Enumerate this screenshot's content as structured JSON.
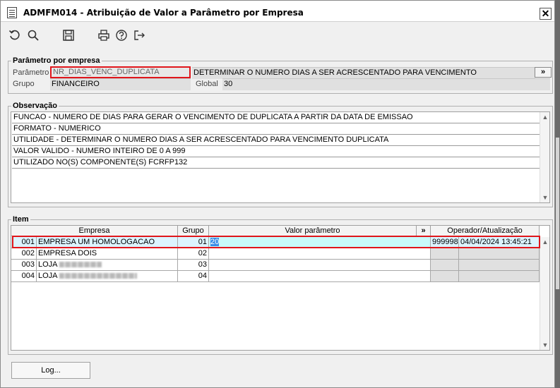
{
  "window": {
    "title": "ADMFM014 - Atribuição de Valor a Parâmetro por Empresa",
    "close_label": "✕"
  },
  "toolbar": {
    "icons": [
      "refresh-icon",
      "search-icon",
      "save-icon",
      "print-icon",
      "help-icon",
      "exit-icon"
    ]
  },
  "param_group": {
    "title": "Parâmetro por empresa",
    "param_label": "Parâmetro",
    "param_value": "NR_DIAS_VENC_DUPLICATA",
    "param_desc": "DETERMINAR O NUMERO DIAS A SER ACRESCENTADO PARA VENCIMENTO",
    "expand_label": "»",
    "group_label": "Grupo",
    "group_value": "FINANCEIRO",
    "global_label": "Global",
    "global_value": "30"
  },
  "observacao": {
    "title": "Observação",
    "lines": [
      "FUNCAO - NUMERO DE DIAS PARA GERAR O VENCIMENTO DE DUPLICATA A PARTIR DA DATA DE EMISSAO",
      "FORMATO - NUMERICO",
      "UTILIDADE - DETERMINAR O NUMERO DIAS A SER ACRESCENTADO PARA VENCIMENTO DUPLICATA",
      "VALOR VALIDO - NUMERO INTEIRO DE 0 A 999",
      "UTILIZADO NO(S) COMPONENTE(S) FCRFP132"
    ]
  },
  "item_group": {
    "title": "Item",
    "headers": {
      "empresa": "Empresa",
      "grupo": "Grupo",
      "valor": "Valor parâmetro",
      "expand": "»",
      "operador": "Operador/Atualização"
    },
    "rows": [
      {
        "code": "001",
        "name": "EMPRESA UM HOMOLOGACAO",
        "grupo": "01",
        "valor": "20",
        "operador": "999998",
        "atualizacao": "04/04/2024 13:45:21"
      },
      {
        "code": "002",
        "name": "EMPRESA DOIS",
        "grupo": "02",
        "valor": "",
        "operador": "",
        "atualizacao": ""
      },
      {
        "code": "003",
        "name": "LOJA",
        "grupo": "03",
        "valor": "",
        "operador": "",
        "atualizacao": ""
      },
      {
        "code": "004",
        "name": "LOJA",
        "grupo": "04",
        "valor": "",
        "operador": "",
        "atualizacao": ""
      }
    ]
  },
  "footer": {
    "log_label": "Log..."
  }
}
